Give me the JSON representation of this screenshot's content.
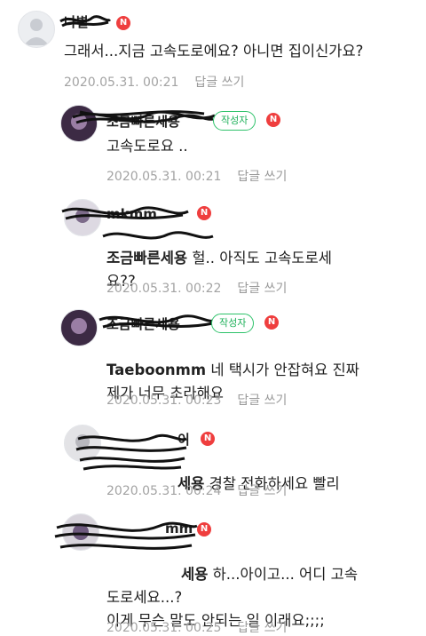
{
  "comments": [
    {
      "name": "나별",
      "badge": "N",
      "text": "그래서...지금 고속도로에요? 아니면 집이신가요?",
      "timestamp": "2020.05.31. 00:21",
      "reply_label": "답글 쓰기",
      "avatar": "default-person-icon"
    },
    {
      "name": "조금빠른세용",
      "author_badge": "작성자",
      "badge": "N",
      "text": "고속도로요 ..",
      "timestamp": "2020.05.31. 00:21",
      "reply_label": "답글 쓰기",
      "avatar": "profile-photo"
    },
    {
      "name": "mkmm",
      "badge": "N",
      "mention": "조금빠른세용",
      "text_first": " 헐.. 아직도 고속도로세",
      "text_rest": "요??",
      "timestamp": "2020.05.31. 00:22",
      "reply_label": "답글 쓰기",
      "avatar": "profile-photo"
    },
    {
      "name": "조금빠른세용",
      "author_badge": "작성자",
      "badge": "N",
      "mention": "Taeboonmm",
      "text_first": " 네 택시가 안잡혀요 진짜",
      "text_rest": "제가 너무 초라해요",
      "timestamp": "2020.05.31. 00:23",
      "reply_label": "답글 쓰기",
      "avatar": "profile-photo"
    },
    {
      "name": "이",
      "badge": "N",
      "mention": "세용",
      "text_first": " 경찰 전화하세요 빨리",
      "timestamp": "2020.05.31. 00:24",
      "reply_label": "답글 쓰기",
      "avatar": "profile-photo"
    },
    {
      "name": "mm",
      "badge": "N",
      "mention": "세용",
      "text_first": " 하...아이고... 어디 고속",
      "text_rest": "도로세요...?\n이게 무슨 말도 안되는 일 이래요;;;;",
      "timestamp": "2020.05.31. 00:25",
      "reply_label": "답글 쓰기",
      "avatar": "profile-photo"
    }
  ],
  "colors": {
    "badge_red": "#ef3e3e",
    "author_green": "#2ec26a",
    "meta_gray": "#a3a3a3"
  }
}
